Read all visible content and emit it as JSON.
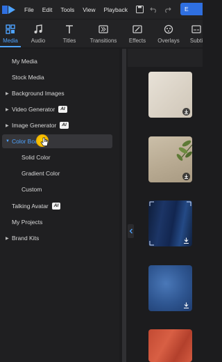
{
  "menubar": {
    "items": [
      "File",
      "Edit",
      "Tools",
      "View",
      "Playback"
    ],
    "export_label": "E"
  },
  "tabs": [
    {
      "label": "Media",
      "icon": "media-icon",
      "active": true
    },
    {
      "label": "Audio",
      "icon": "music-note-icon",
      "active": false
    },
    {
      "label": "Titles",
      "icon": "text-t-icon",
      "active": false
    },
    {
      "label": "Transitions",
      "icon": "transitions-icon",
      "active": false
    },
    {
      "label": "Effects",
      "icon": "effects-icon",
      "active": false
    },
    {
      "label": "Overlays",
      "icon": "overlays-icon",
      "active": false
    },
    {
      "label": "Subti",
      "icon": "subtitles-icon",
      "active": false
    }
  ],
  "sidebar": {
    "items": [
      {
        "label": "My Media",
        "arrow": "",
        "ai": false
      },
      {
        "label": "Stock Media",
        "arrow": "",
        "ai": false
      },
      {
        "label": "Background Images",
        "arrow": "▶",
        "ai": false
      },
      {
        "label": "Video Generator",
        "arrow": "▶",
        "ai": true
      },
      {
        "label": "Image Generator",
        "arrow": "▶",
        "ai": true
      },
      {
        "label": "Color Boa",
        "arrow": "▼",
        "ai": false,
        "selected": true
      },
      {
        "label": "Solid Color",
        "arrow": "",
        "ai": false,
        "sub": true
      },
      {
        "label": "Gradient Color",
        "arrow": "",
        "ai": false,
        "sub": true
      },
      {
        "label": "Custom",
        "arrow": "",
        "ai": false,
        "sub": true
      },
      {
        "label": "Talking Avatar",
        "arrow": "",
        "ai": true
      },
      {
        "label": "My Projects",
        "arrow": "",
        "ai": false
      },
      {
        "label": "Brand Kits",
        "arrow": "▶",
        "ai": false
      }
    ],
    "ai_badge": "AI"
  },
  "colors": {
    "accent": "#4ea3ff",
    "export_bg": "#2f6fe0",
    "cursor": "#ffd400"
  }
}
